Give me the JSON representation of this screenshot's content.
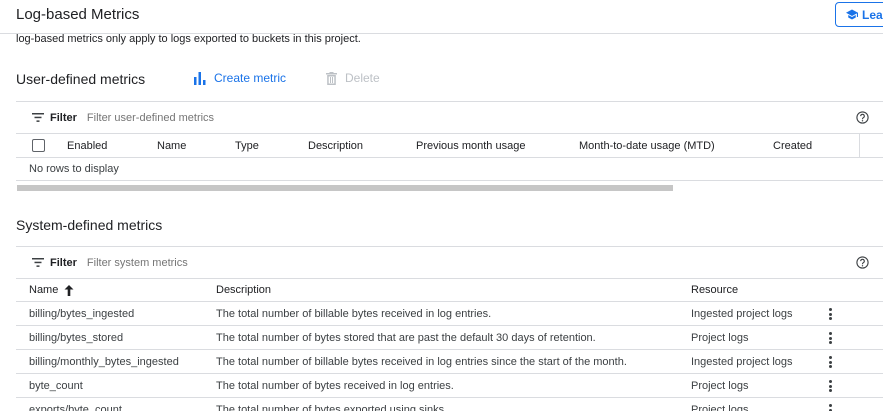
{
  "header": {
    "title": "Log-based Metrics",
    "learn_label": "Lea"
  },
  "info_text": "log-based metrics only apply to logs exported to buckets in this project.",
  "user_section": {
    "title": "User-defined metrics",
    "create_label": "Create metric",
    "delete_label": "Delete",
    "filter_label": "Filter",
    "filter_placeholder": "Filter user-defined metrics",
    "columns": [
      "Enabled",
      "Name",
      "Type",
      "Description",
      "Previous month usage",
      "Month-to-date usage (MTD)",
      "Created"
    ],
    "empty_text": "No rows to display"
  },
  "system_section": {
    "title": "System-defined metrics",
    "filter_label": "Filter",
    "filter_placeholder": "Filter system metrics",
    "columns": [
      "Name",
      "Description",
      "Resource"
    ],
    "rows": [
      {
        "name": "billing/bytes_ingested",
        "description": "The total number of billable bytes received in log entries.",
        "resource": "Ingested project logs"
      },
      {
        "name": "billing/bytes_stored",
        "description": "The total number of bytes stored that are past the default 30 days of retention.",
        "resource": "Project logs"
      },
      {
        "name": "billing/monthly_bytes_ingested",
        "description": "The total number of billable bytes received in log entries since the start of the month.",
        "resource": "Ingested project logs"
      },
      {
        "name": "byte_count",
        "description": "The total number of bytes received in log entries.",
        "resource": "Project logs"
      },
      {
        "name": "exports/byte_count",
        "description": "The total number of bytes exported using sinks.",
        "resource": "Project logs"
      }
    ]
  },
  "icons": {
    "learn": "school-cap-icon",
    "create": "bar-chart-icon",
    "delete": "trash-icon",
    "filter": "filter-icon",
    "help": "help-circle-icon",
    "sort": "arrow-up-icon",
    "row_menu": "more-vert-icon"
  },
  "colors": {
    "accent": "#1a73e8",
    "disabled": "#bdc1c6",
    "divider": "#dadce0"
  }
}
